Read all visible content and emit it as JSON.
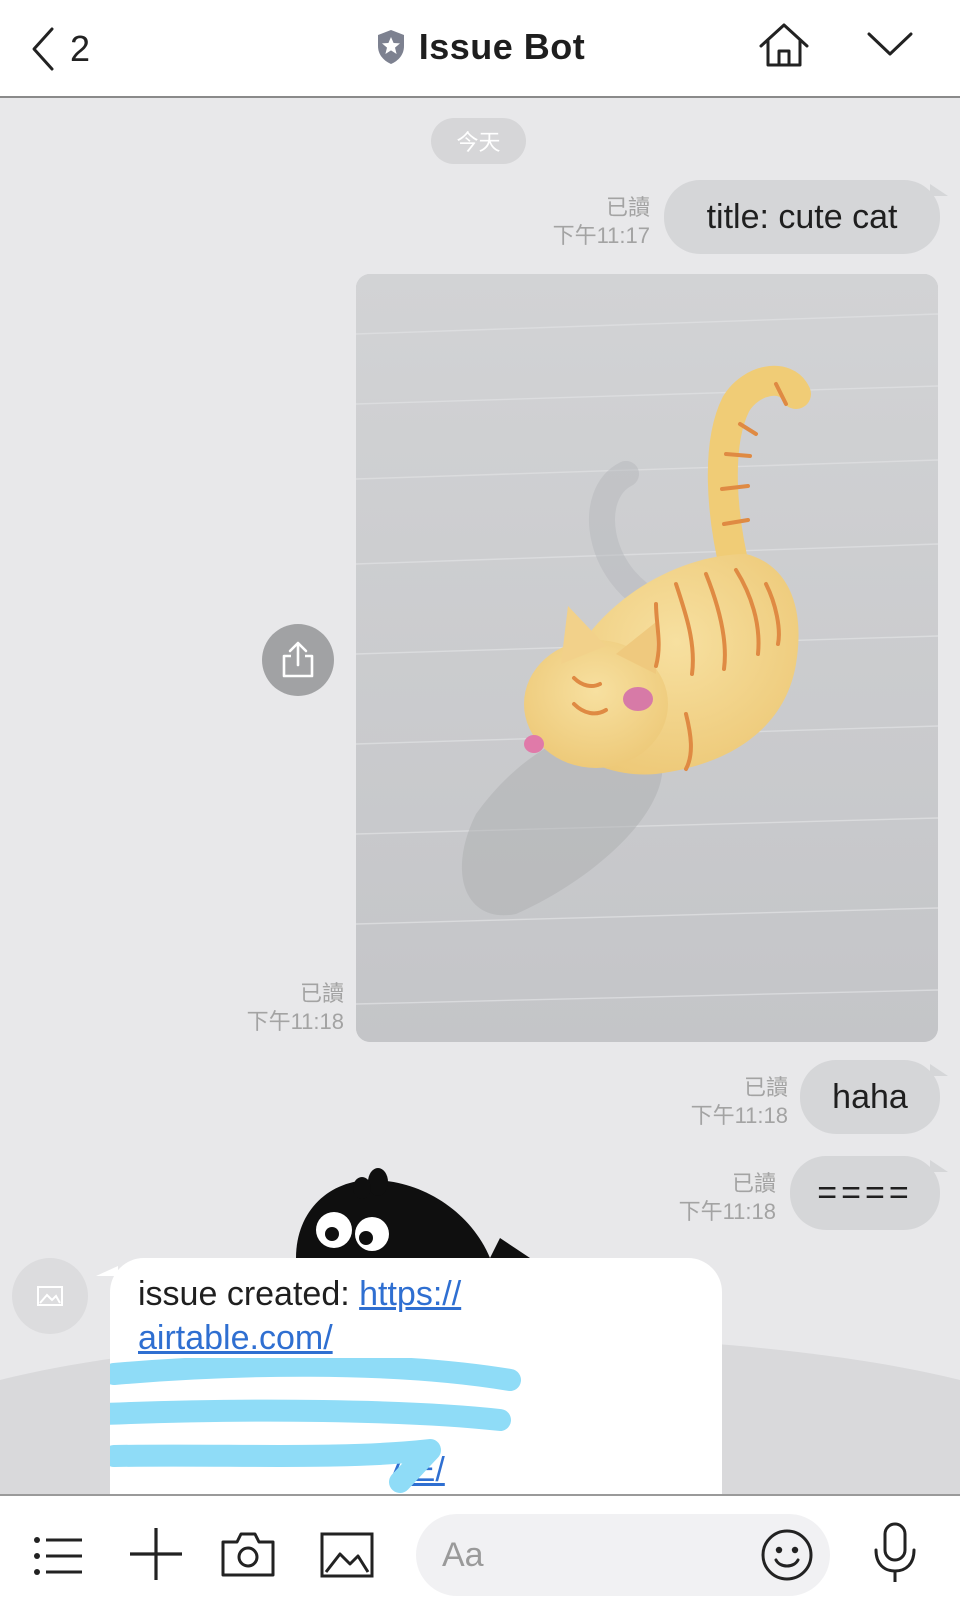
{
  "header": {
    "back_count": "2",
    "title": "Issue Bot",
    "icons": [
      "back-chevron-icon",
      "shield-star-icon",
      "home-icon",
      "chevron-down-icon"
    ]
  },
  "chat": {
    "date_label": "今天",
    "messages": [
      {
        "direction": "out",
        "type": "text",
        "text": "title: cute cat",
        "read": "已讀",
        "time": "下午11:17"
      },
      {
        "direction": "out",
        "type": "image",
        "read": "已讀",
        "time": "下午11:18"
      },
      {
        "direction": "out",
        "type": "text",
        "text": "haha",
        "read": "已讀",
        "time": "下午11:18"
      },
      {
        "direction": "out",
        "type": "text",
        "text": "====",
        "read": "已讀",
        "time": "下午11:18"
      }
    ],
    "incoming": {
      "prefix": "issue created: ",
      "link_lines": [
        "https://",
        "airtable.com/",
        "",
        "",
        "AE/"
      ]
    }
  },
  "toolbar": {
    "input_placeholder": "Aa",
    "icons": [
      "menu-list-icon",
      "plus-icon",
      "camera-icon",
      "image-icon",
      "emoji-icon",
      "microphone-icon"
    ]
  },
  "colors": {
    "chat_background": "#e8e8ea",
    "outgoing_bubble": "#d5d6d8",
    "link": "#2f6fd1",
    "scribble": "#8fdcf7"
  }
}
